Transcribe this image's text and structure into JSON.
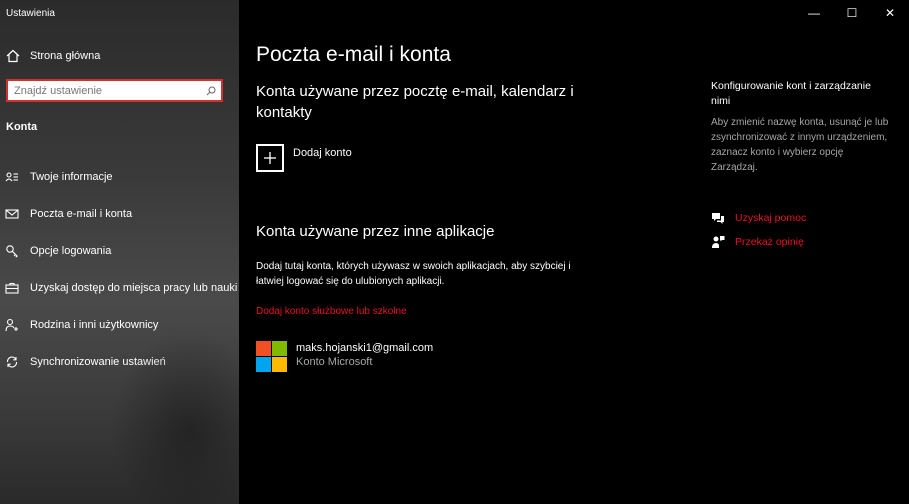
{
  "window": {
    "title": "Ustawienia",
    "minimize_glyph": "—",
    "maximize_glyph": "☐",
    "close_glyph": "✕"
  },
  "sidebar": {
    "home_label": "Strona główna",
    "search_placeholder": "Znajdź ustawienie",
    "section_label": "Konta",
    "items": [
      {
        "label": "Twoje informacje",
        "icon": "contact-card-icon"
      },
      {
        "label": "Poczta e-mail i konta",
        "icon": "mail-icon"
      },
      {
        "label": "Opcje logowania",
        "icon": "key-icon"
      },
      {
        "label": "Uzyskaj dostęp do miejsca pracy lub nauki",
        "icon": "briefcase-icon"
      },
      {
        "label": "Rodzina i inni użytkownicy",
        "icon": "person-add-icon"
      },
      {
        "label": "Synchronizowanie ustawień",
        "icon": "sync-icon"
      }
    ]
  },
  "main": {
    "title": "Poczta e-mail i konta",
    "section1_heading": "Konta używane przez pocztę e-mail, kalendarz i kontakty",
    "add_account_label": "Dodaj konto",
    "section2_heading": "Konta używane przez inne aplikacje",
    "section2_description": "Dodaj tutaj konta, których używasz w swoich aplikacjach, aby szybciej i łatwiej logować się do ulubionych aplikacji.",
    "add_work_account_link": "Dodaj konto służbowe lub szkolne",
    "account": {
      "email": "maks.hojanski1@gmail.com",
      "type": "Konto Microsoft"
    }
  },
  "right_panel": {
    "title": "Konfigurowanie kont i zarządzanie nimi",
    "body": "Aby zmienić nazwę konta, usunąć je lub zsynchronizować z innym urządzeniem, zaznacz konto i wybierz opcję Zarządzaj.",
    "help_link": "Uzyskaj pomoc",
    "feedback_link": "Przekaż opinię"
  },
  "colors": {
    "accent_red": "#e81123",
    "ms_red": "#f25022",
    "ms_green": "#7fba00",
    "ms_blue": "#00a4ef",
    "ms_yellow": "#ffb900"
  }
}
